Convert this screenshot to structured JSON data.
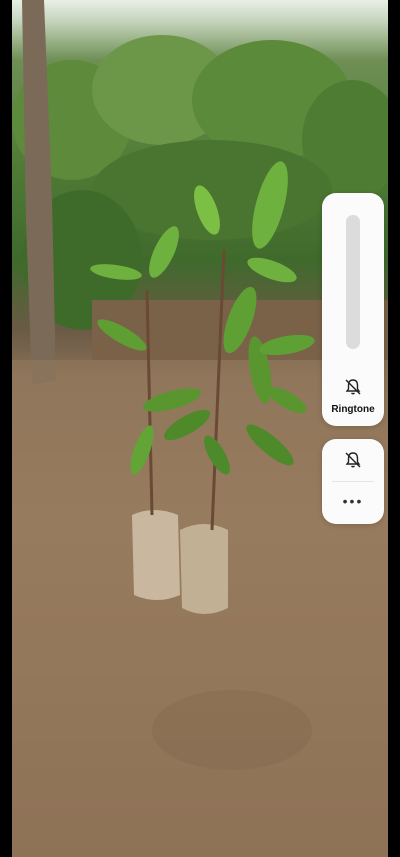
{
  "volume_panel": {
    "level": 0.0,
    "mode_label": "Ringtone",
    "mode_icon": "bell-off-icon"
  },
  "mode_panel": {
    "icon": "bell-off-icon",
    "more_label": "•••"
  },
  "colors": {
    "panel_bg": "#fbfbfb",
    "track": "#dcdcdc",
    "text": "#111111"
  }
}
